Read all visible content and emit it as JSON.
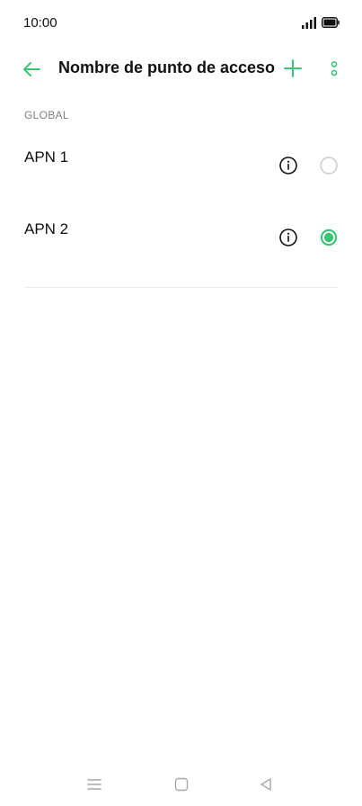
{
  "status_bar": {
    "time": "10:00",
    "icons": [
      "signal-icon",
      "battery-icon"
    ]
  },
  "app_bar": {
    "title": "Nombre de punto de acceso",
    "icons": [
      "back-arrow-icon",
      "plus-icon",
      "more-vertical-icon"
    ]
  },
  "colors": {
    "accent": "#3cc477",
    "text": "#111111",
    "section": "#808080",
    "divider": "#ebebeb"
  },
  "section": {
    "header": "GLOBAL"
  },
  "apns": [
    {
      "name": "APN 1",
      "selected": false
    },
    {
      "name": "APN 2",
      "selected": true
    }
  ],
  "nav_bar": {
    "icons": [
      "menu-lines-icon",
      "square-home-icon",
      "triangle-back-icon"
    ]
  }
}
